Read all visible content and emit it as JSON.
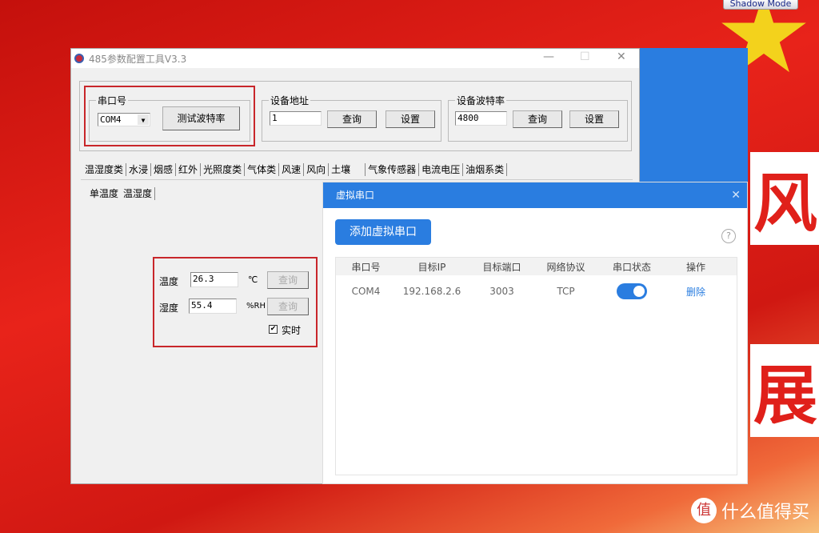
{
  "overlay": {
    "shadow_mode": "Shadow Mode"
  },
  "background": {
    "char1": "风",
    "char2": "展"
  },
  "watermark": {
    "logo": "值",
    "text": "什么值得买"
  },
  "window": {
    "title": "485参数配置工具V3.3",
    "port_group": {
      "legend": "串口号",
      "port_value": "COM4",
      "test_button": "测试波特率"
    },
    "address_group": {
      "legend": "设备地址",
      "value": "1",
      "query": "查询",
      "set": "设置"
    },
    "baud_group": {
      "legend": "设备波特率",
      "value": "4800",
      "query": "查询",
      "set": "设置"
    },
    "tabs": [
      "温湿度类",
      "水浸",
      "烟感",
      "红外",
      "光照度类",
      "气体类",
      "风速",
      "风向",
      "土壤",
      "气象传感器",
      "电流电压",
      "油烟系类"
    ],
    "subtabs": [
      "单温度",
      "温湿度"
    ],
    "readings": {
      "temp_label": "温度",
      "temp_value": "26.3",
      "temp_unit": "℃",
      "temp_query": "查询",
      "hum_label": "湿度",
      "hum_value": "55.4",
      "hum_unit": "%RH",
      "hum_query": "查询",
      "realtime_label": "实时",
      "realtime_checked": true
    }
  },
  "dialog": {
    "title": "虚拟串口",
    "add_button": "添加虚拟串口",
    "help": "?",
    "columns": [
      "串口号",
      "目标IP",
      "目标端口",
      "网络协议",
      "串口状态",
      "操作"
    ],
    "rows": [
      {
        "port": "COM4",
        "ip": "192.168.2.6",
        "target_port": "3003",
        "protocol": "TCP",
        "status_on": true,
        "action": "删除"
      }
    ]
  },
  "colors": {
    "accent": "#2a7de0",
    "highlight_box": "#c8262a"
  }
}
